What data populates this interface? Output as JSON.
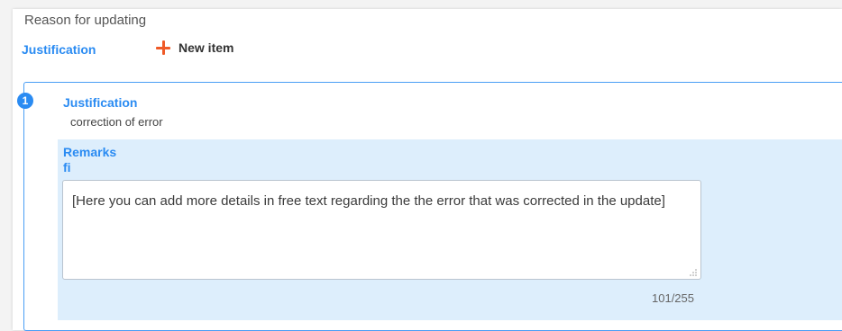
{
  "section": {
    "title": "Reason for updating"
  },
  "justification_field": {
    "label": "Justification",
    "new_item_label": "New item"
  },
  "item": {
    "number": "1",
    "justification_label": "Justification",
    "justification_value": "correction of error",
    "remarks_label": "Remarks",
    "language": "fi",
    "remarks_text": "[Here you can add more details in free text regarding the the error that was corrected in the update]",
    "char_count": "101/255"
  },
  "colors": {
    "accent": "#2a8bf2",
    "add_icon": "#ef5a27",
    "remarks_background": "#ddeefc"
  },
  "icons": {
    "add": "plus-icon",
    "resize": "resize-grip-icon"
  }
}
